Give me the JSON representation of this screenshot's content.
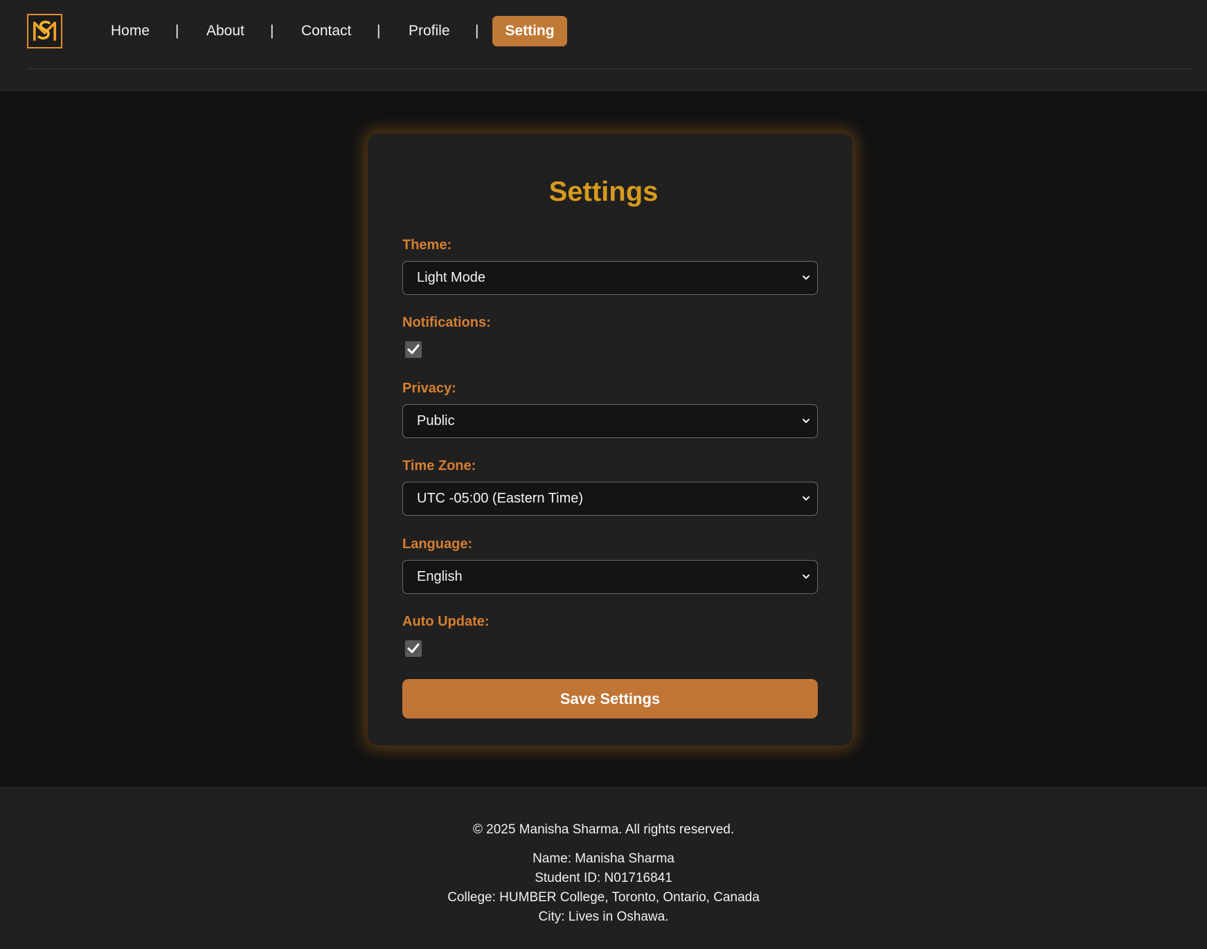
{
  "nav": {
    "logo_icon": "ms-monogram-logo-icon",
    "links": [
      "Home",
      "About",
      "Contact",
      "Profile"
    ],
    "separator": "|",
    "active_label": "Setting"
  },
  "settings": {
    "title": "Settings",
    "theme_label": "Theme:",
    "theme_value": "Light Mode",
    "notifications_label": "Notifications:",
    "notifications_checked": true,
    "privacy_label": "Privacy:",
    "privacy_value": "Public",
    "timezone_label": "Time Zone:",
    "timezone_value": "UTC -05:00 (Eastern Time)",
    "language_label": "Language:",
    "language_value": "English",
    "autoupdate_label": "Auto Update:",
    "autoupdate_checked": true,
    "save_label": "Save Settings"
  },
  "footer": {
    "copyright": "© 2025 Manisha Sharma. All rights reserved.",
    "name": "Name: Manisha Sharma",
    "student_id": "Student ID: N01716841",
    "college": "College: HUMBER College, Toronto, Ontario, Canada",
    "city": "City: Lives in Oshawa."
  },
  "colors": {
    "accent": "#c07a35",
    "title": "#d69a1e",
    "label": "#d67f30",
    "background": "#121212",
    "panel": "#202020"
  }
}
